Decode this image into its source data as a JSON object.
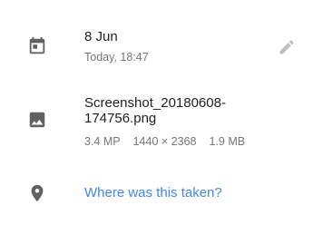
{
  "date": {
    "title": "8 Jun",
    "subtitle": "Today, 18:47",
    "icon": "calendar-icon",
    "edit_icon": "pencil-icon"
  },
  "file": {
    "name_line1": "Screenshot_20180608-",
    "name_line2": "174756.png",
    "megapixels": "3.4 MP",
    "dimensions": "1440 × 2368",
    "size": "1.9 MB",
    "icon": "image-icon"
  },
  "location": {
    "prompt": "Where was this taken?",
    "icon": "location-pin-icon",
    "link_color": "#4285f4"
  },
  "colors": {
    "icon": "#616161",
    "edit_icon": "#bdbdbd",
    "primary_text": "#212121",
    "secondary_text": "#757575"
  }
}
